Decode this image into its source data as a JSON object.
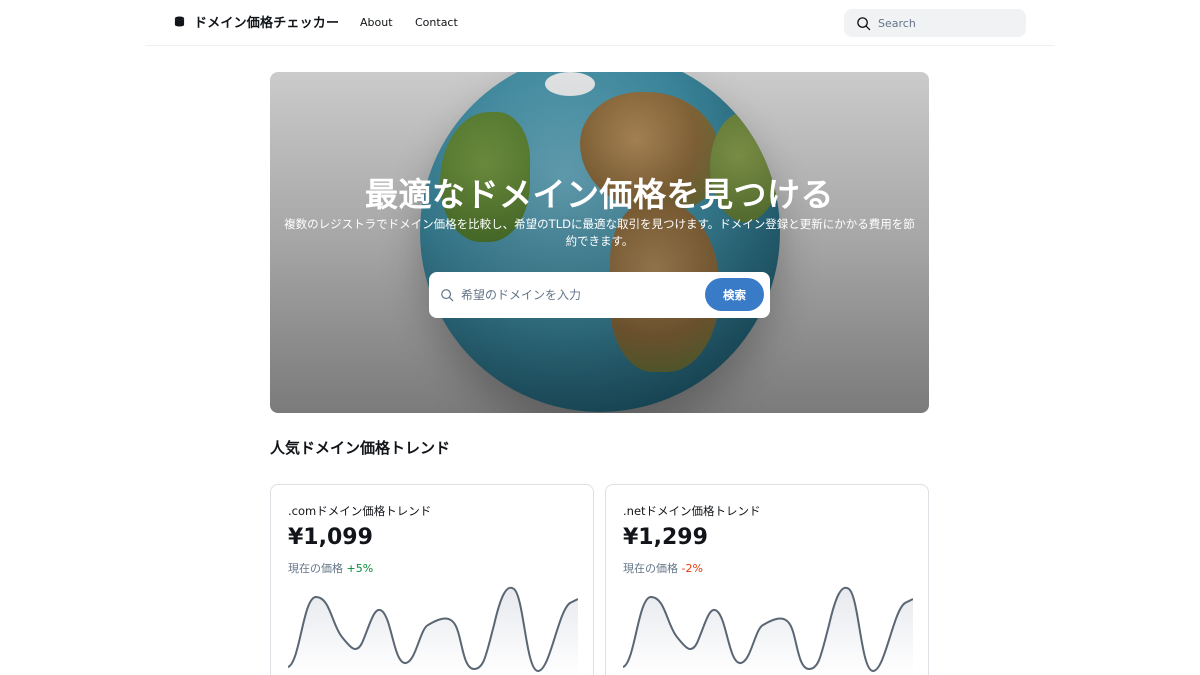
{
  "header": {
    "brand": "ドメイン価格チェッカー",
    "nav": [
      {
        "label": "About"
      },
      {
        "label": "Contact"
      }
    ],
    "search_placeholder": "Search"
  },
  "hero": {
    "title": "最適なドメイン価格を見つける",
    "subtitle": "複数のレジストラでドメイン価格を比較し、希望のTLDに最適な取引を見つけます。ドメイン登録と更新にかかる費用を節約できます。",
    "search_placeholder": "希望のドメインを入力",
    "search_button": "検索"
  },
  "trends": {
    "title": "人気ドメイン価格トレンド",
    "cards": [
      {
        "title": ".comドメイン価格トレンド",
        "price": "¥1,099",
        "label": "現在の価格",
        "change": "+5%",
        "change_color": "#07883b"
      },
      {
        "title": ".netドメイン価格トレンド",
        "price": "¥1,299",
        "label": "現在の価格",
        "change": "-2%",
        "change_color": "#e73908"
      }
    ]
  },
  "colors": {
    "accent": "#3a7bc8",
    "text_primary": "#111418",
    "text_secondary": "#637588",
    "positive": "#07883b",
    "negative": "#e73908"
  }
}
